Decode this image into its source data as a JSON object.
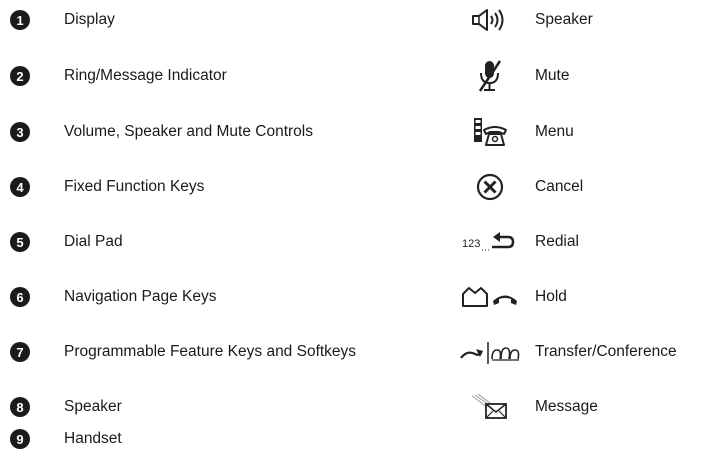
{
  "items": [
    {
      "number": "1",
      "label": "Display"
    },
    {
      "number": "2",
      "label": "Ring/Message Indicator"
    },
    {
      "number": "3",
      "label": "Volume, Speaker and Mute Controls"
    },
    {
      "number": "4",
      "label": "Fixed Function Keys"
    },
    {
      "number": "5",
      "label": "Dial Pad"
    },
    {
      "number": "6",
      "label": "Navigation Page Keys"
    },
    {
      "number": "7",
      "label": "Programmable Feature Keys and Softkeys"
    },
    {
      "number": "8",
      "label": "Speaker"
    },
    {
      "number": "9",
      "label": "Handset"
    }
  ],
  "keys": [
    {
      "icon": "speaker-icon",
      "label": "Speaker"
    },
    {
      "icon": "mute-icon",
      "label": "Mute"
    },
    {
      "icon": "menu-icon",
      "label": "Menu"
    },
    {
      "icon": "cancel-icon",
      "label": "Cancel"
    },
    {
      "icon": "redial-icon",
      "label": "Redial",
      "glyph": "123"
    },
    {
      "icon": "hold-icon",
      "label": "Hold"
    },
    {
      "icon": "transfer-conference-icon",
      "label": "Transfer/Conference"
    },
    {
      "icon": "message-icon",
      "label": "Message"
    }
  ]
}
